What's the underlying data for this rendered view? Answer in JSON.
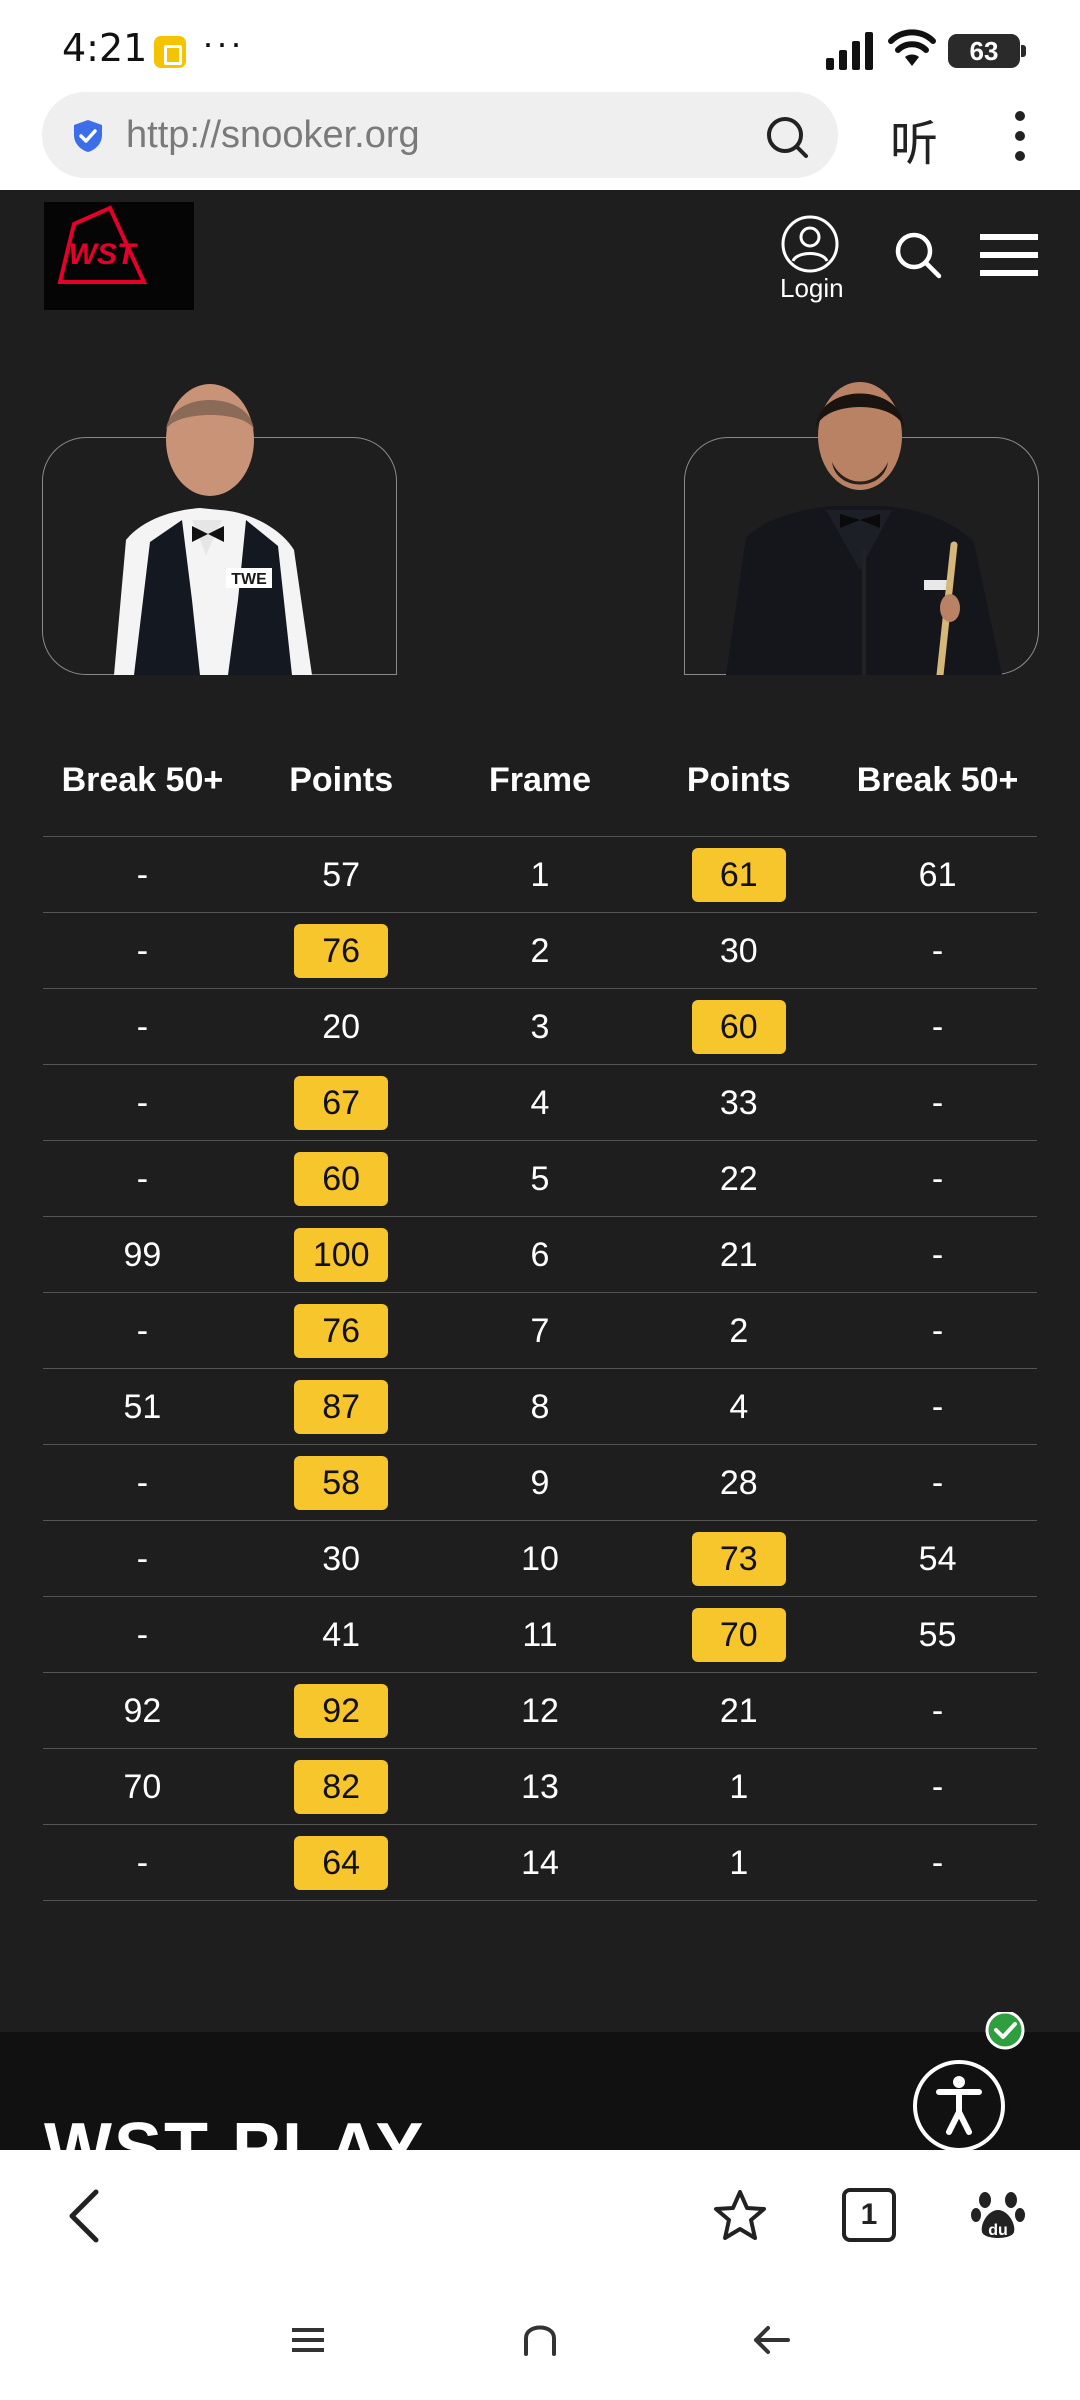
{
  "status_bar": {
    "time": "4:21",
    "more": "···",
    "battery": "63"
  },
  "browser": {
    "url": "http://snooker.org",
    "listen_label": "听"
  },
  "site": {
    "logo_text": "WST",
    "login_label": "Login"
  },
  "players": [
    {
      "side": "left",
      "vest_badge": "TWE"
    },
    {
      "side": "right"
    }
  ],
  "table": {
    "headers": [
      "Break 50+",
      "Points",
      "Frame",
      "Points",
      "Break 50+"
    ],
    "rows": [
      {
        "lb": "-",
        "lp": "57",
        "frame": "1",
        "rp": "61",
        "rb": "61",
        "winner": "right"
      },
      {
        "lb": "-",
        "lp": "76",
        "frame": "2",
        "rp": "30",
        "rb": "-",
        "winner": "left"
      },
      {
        "lb": "-",
        "lp": "20",
        "frame": "3",
        "rp": "60",
        "rb": "-",
        "winner": "right"
      },
      {
        "lb": "-",
        "lp": "67",
        "frame": "4",
        "rp": "33",
        "rb": "-",
        "winner": "left"
      },
      {
        "lb": "-",
        "lp": "60",
        "frame": "5",
        "rp": "22",
        "rb": "-",
        "winner": "left"
      },
      {
        "lb": "99",
        "lp": "100",
        "frame": "6",
        "rp": "21",
        "rb": "-",
        "winner": "left"
      },
      {
        "lb": "-",
        "lp": "76",
        "frame": "7",
        "rp": "2",
        "rb": "-",
        "winner": "left"
      },
      {
        "lb": "51",
        "lp": "87",
        "frame": "8",
        "rp": "4",
        "rb": "-",
        "winner": "left"
      },
      {
        "lb": "-",
        "lp": "58",
        "frame": "9",
        "rp": "28",
        "rb": "-",
        "winner": "left"
      },
      {
        "lb": "-",
        "lp": "30",
        "frame": "10",
        "rp": "73",
        "rb": "54",
        "winner": "right"
      },
      {
        "lb": "-",
        "lp": "41",
        "frame": "11",
        "rp": "70",
        "rb": "55",
        "winner": "right"
      },
      {
        "lb": "92",
        "lp": "92",
        "frame": "12",
        "rp": "21",
        "rb": "-",
        "winner": "left"
      },
      {
        "lb": "70",
        "lp": "82",
        "frame": "13",
        "rp": "1",
        "rb": "-",
        "winner": "left"
      },
      {
        "lb": "-",
        "lp": "64",
        "frame": "14",
        "rp": "1",
        "rb": "-",
        "winner": "left"
      }
    ]
  },
  "footer": {
    "section_title": "WST PLAY"
  },
  "bottom_nav": {
    "tab_count": "1"
  },
  "colors": {
    "accent": "#f7c52c",
    "background": "#1e1e1e",
    "brand_red": "#e4002b",
    "a11y_check": "#2e9e3e"
  }
}
